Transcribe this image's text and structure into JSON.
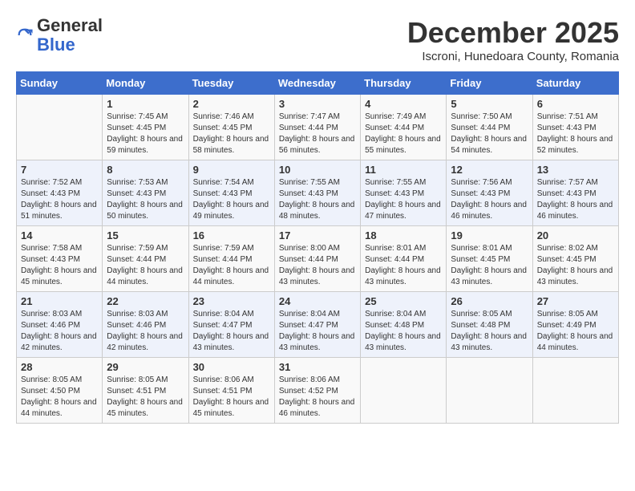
{
  "logo": {
    "general": "General",
    "blue": "Blue"
  },
  "title": {
    "month": "December 2025",
    "location": "Iscroni, Hunedoara County, Romania"
  },
  "weekdays": [
    "Sunday",
    "Monday",
    "Tuesday",
    "Wednesday",
    "Thursday",
    "Friday",
    "Saturday"
  ],
  "weeks": [
    [
      {
        "day": "",
        "sunrise": "",
        "sunset": "",
        "daylight": ""
      },
      {
        "day": "1",
        "sunrise": "Sunrise: 7:45 AM",
        "sunset": "Sunset: 4:45 PM",
        "daylight": "Daylight: 8 hours and 59 minutes."
      },
      {
        "day": "2",
        "sunrise": "Sunrise: 7:46 AM",
        "sunset": "Sunset: 4:45 PM",
        "daylight": "Daylight: 8 hours and 58 minutes."
      },
      {
        "day": "3",
        "sunrise": "Sunrise: 7:47 AM",
        "sunset": "Sunset: 4:44 PM",
        "daylight": "Daylight: 8 hours and 56 minutes."
      },
      {
        "day": "4",
        "sunrise": "Sunrise: 7:49 AM",
        "sunset": "Sunset: 4:44 PM",
        "daylight": "Daylight: 8 hours and 55 minutes."
      },
      {
        "day": "5",
        "sunrise": "Sunrise: 7:50 AM",
        "sunset": "Sunset: 4:44 PM",
        "daylight": "Daylight: 8 hours and 54 minutes."
      },
      {
        "day": "6",
        "sunrise": "Sunrise: 7:51 AM",
        "sunset": "Sunset: 4:43 PM",
        "daylight": "Daylight: 8 hours and 52 minutes."
      }
    ],
    [
      {
        "day": "7",
        "sunrise": "Sunrise: 7:52 AM",
        "sunset": "Sunset: 4:43 PM",
        "daylight": "Daylight: 8 hours and 51 minutes."
      },
      {
        "day": "8",
        "sunrise": "Sunrise: 7:53 AM",
        "sunset": "Sunset: 4:43 PM",
        "daylight": "Daylight: 8 hours and 50 minutes."
      },
      {
        "day": "9",
        "sunrise": "Sunrise: 7:54 AM",
        "sunset": "Sunset: 4:43 PM",
        "daylight": "Daylight: 8 hours and 49 minutes."
      },
      {
        "day": "10",
        "sunrise": "Sunrise: 7:55 AM",
        "sunset": "Sunset: 4:43 PM",
        "daylight": "Daylight: 8 hours and 48 minutes."
      },
      {
        "day": "11",
        "sunrise": "Sunrise: 7:55 AM",
        "sunset": "Sunset: 4:43 PM",
        "daylight": "Daylight: 8 hours and 47 minutes."
      },
      {
        "day": "12",
        "sunrise": "Sunrise: 7:56 AM",
        "sunset": "Sunset: 4:43 PM",
        "daylight": "Daylight: 8 hours and 46 minutes."
      },
      {
        "day": "13",
        "sunrise": "Sunrise: 7:57 AM",
        "sunset": "Sunset: 4:43 PM",
        "daylight": "Daylight: 8 hours and 46 minutes."
      }
    ],
    [
      {
        "day": "14",
        "sunrise": "Sunrise: 7:58 AM",
        "sunset": "Sunset: 4:43 PM",
        "daylight": "Daylight: 8 hours and 45 minutes."
      },
      {
        "day": "15",
        "sunrise": "Sunrise: 7:59 AM",
        "sunset": "Sunset: 4:44 PM",
        "daylight": "Daylight: 8 hours and 44 minutes."
      },
      {
        "day": "16",
        "sunrise": "Sunrise: 7:59 AM",
        "sunset": "Sunset: 4:44 PM",
        "daylight": "Daylight: 8 hours and 44 minutes."
      },
      {
        "day": "17",
        "sunrise": "Sunrise: 8:00 AM",
        "sunset": "Sunset: 4:44 PM",
        "daylight": "Daylight: 8 hours and 43 minutes."
      },
      {
        "day": "18",
        "sunrise": "Sunrise: 8:01 AM",
        "sunset": "Sunset: 4:44 PM",
        "daylight": "Daylight: 8 hours and 43 minutes."
      },
      {
        "day": "19",
        "sunrise": "Sunrise: 8:01 AM",
        "sunset": "Sunset: 4:45 PM",
        "daylight": "Daylight: 8 hours and 43 minutes."
      },
      {
        "day": "20",
        "sunrise": "Sunrise: 8:02 AM",
        "sunset": "Sunset: 4:45 PM",
        "daylight": "Daylight: 8 hours and 43 minutes."
      }
    ],
    [
      {
        "day": "21",
        "sunrise": "Sunrise: 8:03 AM",
        "sunset": "Sunset: 4:46 PM",
        "daylight": "Daylight: 8 hours and 42 minutes."
      },
      {
        "day": "22",
        "sunrise": "Sunrise: 8:03 AM",
        "sunset": "Sunset: 4:46 PM",
        "daylight": "Daylight: 8 hours and 42 minutes."
      },
      {
        "day": "23",
        "sunrise": "Sunrise: 8:04 AM",
        "sunset": "Sunset: 4:47 PM",
        "daylight": "Daylight: 8 hours and 43 minutes."
      },
      {
        "day": "24",
        "sunrise": "Sunrise: 8:04 AM",
        "sunset": "Sunset: 4:47 PM",
        "daylight": "Daylight: 8 hours and 43 minutes."
      },
      {
        "day": "25",
        "sunrise": "Sunrise: 8:04 AM",
        "sunset": "Sunset: 4:48 PM",
        "daylight": "Daylight: 8 hours and 43 minutes."
      },
      {
        "day": "26",
        "sunrise": "Sunrise: 8:05 AM",
        "sunset": "Sunset: 4:48 PM",
        "daylight": "Daylight: 8 hours and 43 minutes."
      },
      {
        "day": "27",
        "sunrise": "Sunrise: 8:05 AM",
        "sunset": "Sunset: 4:49 PM",
        "daylight": "Daylight: 8 hours and 44 minutes."
      }
    ],
    [
      {
        "day": "28",
        "sunrise": "Sunrise: 8:05 AM",
        "sunset": "Sunset: 4:50 PM",
        "daylight": "Daylight: 8 hours and 44 minutes."
      },
      {
        "day": "29",
        "sunrise": "Sunrise: 8:05 AM",
        "sunset": "Sunset: 4:51 PM",
        "daylight": "Daylight: 8 hours and 45 minutes."
      },
      {
        "day": "30",
        "sunrise": "Sunrise: 8:06 AM",
        "sunset": "Sunset: 4:51 PM",
        "daylight": "Daylight: 8 hours and 45 minutes."
      },
      {
        "day": "31",
        "sunrise": "Sunrise: 8:06 AM",
        "sunset": "Sunset: 4:52 PM",
        "daylight": "Daylight: 8 hours and 46 minutes."
      },
      {
        "day": "",
        "sunrise": "",
        "sunset": "",
        "daylight": ""
      },
      {
        "day": "",
        "sunrise": "",
        "sunset": "",
        "daylight": ""
      },
      {
        "day": "",
        "sunrise": "",
        "sunset": "",
        "daylight": ""
      }
    ]
  ]
}
